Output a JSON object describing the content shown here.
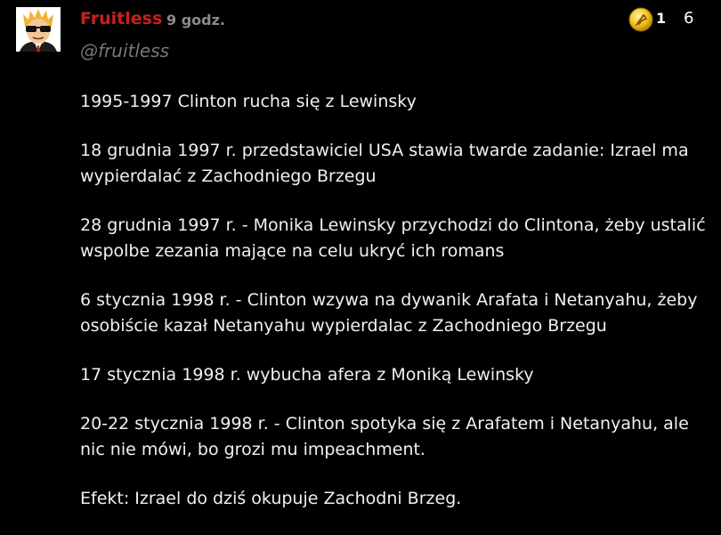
{
  "post": {
    "username": "Fruitless",
    "time": "9 godz.",
    "handle": "@fruitless",
    "award_count": "1",
    "score": "6",
    "avatar_icon": "sunglasses-avatar-icon",
    "award_icon": "gold-award-icon",
    "paragraphs": [
      "1995-1997 Clinton rucha się z Lewinsky",
      "18 grudnia 1997 r. przedstawiciel USA stawia twarde zadanie: Izrael ma wypierdalać z Zachodniego Brzegu",
      "28 grudnia 1997 r. - Monika Lewinsky przychodzi do Clintona, żeby ustalić wspolbe zezania mające na celu ukryć ich romans",
      "6 stycznia 1998 r. - Clinton wzywa na dywanik Arafata i Netanyahu, żeby osobiście kazał Netanyahu wypierdalac z Zachodniego Brzegu",
      "17 stycznia 1998 r. wybucha afera z Moniką Lewinsky",
      "20-22 stycznia 1998 r. - Clinton spotyka się z Arafatem i Netanyahu, ale nic nie mówi, bo grozi mu impeachment.",
      "Efekt: Izrael do dziś okupuje Zachodni Brzeg."
    ]
  },
  "colors": {
    "background": "#000000",
    "username": "#c8201e",
    "meta": "#8b8b8b",
    "text": "#f0f0f0"
  }
}
